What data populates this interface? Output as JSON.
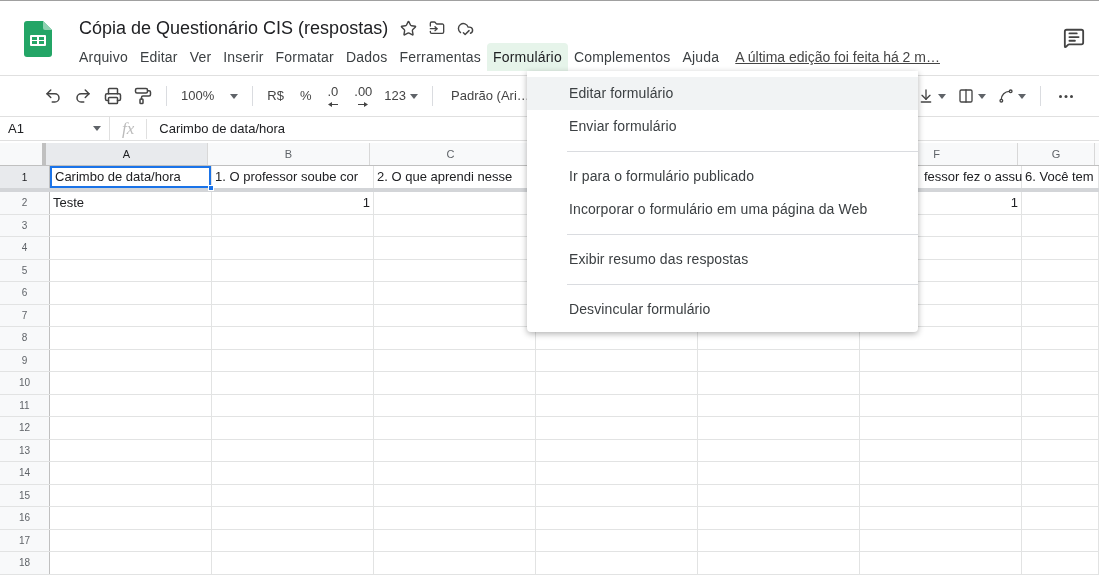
{
  "document": {
    "title": "Cópia de Questionário CIS (respostas)"
  },
  "menu_bar": [
    {
      "label": "Arquivo",
      "selected": false
    },
    {
      "label": "Editar",
      "selected": false
    },
    {
      "label": "Ver",
      "selected": false
    },
    {
      "label": "Inserir",
      "selected": false
    },
    {
      "label": "Formatar",
      "selected": false
    },
    {
      "label": "Dados",
      "selected": false
    },
    {
      "label": "Ferramentas",
      "selected": false
    },
    {
      "label": "Formulário",
      "selected": true
    },
    {
      "label": "Complementos",
      "selected": false
    },
    {
      "label": "Ajuda",
      "selected": false
    }
  ],
  "last_edit": "A última edição foi feita há 2 m…",
  "toolbar": {
    "zoom": "100%",
    "currency": "R$",
    "percent": "%",
    "decrease_decimals": ".0",
    "increase_decimals": ".00",
    "number_format": "123",
    "font": "Padrão (Ari…"
  },
  "formula_bar": {
    "cell_ref": "A1",
    "fx": "fx",
    "value": "Carimbo de data/hora"
  },
  "sheet": {
    "columns": [
      {
        "label": "A",
        "selected": true
      },
      {
        "label": "B",
        "selected": false
      },
      {
        "label": "C",
        "selected": false
      },
      null,
      null,
      {
        "label": "F",
        "selected": false
      },
      {
        "label": "G",
        "selected": false
      }
    ],
    "rows": [
      {
        "label": "1",
        "selected": true,
        "cells": [
          {
            "text": "Carimbo de data/hora",
            "kind": "text",
            "selected": true
          },
          {
            "text": "1. O professor soube cor",
            "kind": "text",
            "selected": false
          },
          {
            "text": "2. O que aprendi nesse",
            "kind": "text",
            "selected": false
          },
          null,
          null,
          {
            "text": "fessor fez o assu",
            "kind": "text",
            "selected": false
          },
          {
            "text": "6. Você tem",
            "kind": "text",
            "selected": false
          }
        ]
      },
      {
        "label": "2",
        "selected": false,
        "cells": [
          {
            "text": "Teste",
            "kind": "text",
            "selected": false
          },
          {
            "text": "1",
            "kind": "number",
            "selected": false
          },
          null,
          null,
          null,
          {
            "text": "1",
            "kind": "number",
            "selected": false
          },
          null
        ]
      },
      {
        "label": "3",
        "selected": false
      },
      {
        "label": "4",
        "selected": false
      },
      {
        "label": "5",
        "selected": false
      },
      {
        "label": "6",
        "selected": false
      },
      {
        "label": "7",
        "selected": false
      },
      {
        "label": "8",
        "selected": false
      },
      {
        "label": "9",
        "selected": false
      },
      {
        "label": "10",
        "selected": false
      },
      {
        "label": "11",
        "selected": false
      },
      {
        "label": "12",
        "selected": false
      },
      {
        "label": "13",
        "selected": false
      },
      {
        "label": "14",
        "selected": false
      },
      {
        "label": "15",
        "selected": false
      },
      {
        "label": "16",
        "selected": false
      },
      {
        "label": "17",
        "selected": false
      },
      {
        "label": "18",
        "selected": false
      }
    ]
  },
  "dropdown_menu": [
    {
      "kind": "item",
      "label": "Editar formulário",
      "highlighted": true
    },
    {
      "kind": "item",
      "label": "Enviar formulário",
      "highlighted": false
    },
    {
      "kind": "separator"
    },
    {
      "kind": "item",
      "label": "Ir para o formulário publicado",
      "highlighted": false
    },
    {
      "kind": "item",
      "label": "Incorporar o formulário em uma página da Web",
      "highlighted": false
    },
    {
      "kind": "separator"
    },
    {
      "kind": "item",
      "label": "Exibir resumo das respostas",
      "highlighted": false
    },
    {
      "kind": "separator"
    },
    {
      "kind": "item",
      "label": "Desvincular formulário",
      "highlighted": false
    }
  ]
}
